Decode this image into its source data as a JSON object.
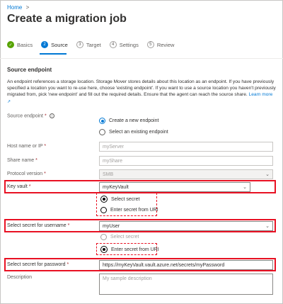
{
  "breadcrumb": {
    "home": "Home",
    "separator": ">"
  },
  "page_title": "Create a migration job",
  "steps": [
    {
      "num": "✓",
      "label": "Basics",
      "state": "done"
    },
    {
      "num": "2",
      "label": "Source",
      "state": "active"
    },
    {
      "num": "3",
      "label": "Target",
      "state": "pending"
    },
    {
      "num": "4",
      "label": "Settings",
      "state": "pending"
    },
    {
      "num": "5",
      "label": "Review",
      "state": "pending"
    }
  ],
  "section": {
    "title": "Source endpoint",
    "description": "An endpoint references a storage location. Storage Mover stores details about this location as an endpoint. If you have previously specified a location you want to re-use here, choose 'existing endpoint'. If you want to use a source location you haven't previously migrated from, pick 'new endpoint' and fill out the required details. Ensure that the agent can reach the source share.",
    "learn_more": "Learn more"
  },
  "fields": {
    "source_endpoint": {
      "label": "Source endpoint",
      "required": "*",
      "options": [
        "Create a new endpoint",
        "Select an existing endpoint"
      ],
      "selected": "Create a new endpoint"
    },
    "host": {
      "label": "Host name or IP",
      "required": "*",
      "placeholder": "myServer"
    },
    "share": {
      "label": "Share name",
      "required": "*",
      "placeholder": "myShare"
    },
    "protocol": {
      "label": "Protocol version",
      "required": "*",
      "value": "SMB"
    },
    "key_vault": {
      "label": "Key vault",
      "required": "*",
      "value": "myKeyVault"
    },
    "secret_mode_1": {
      "options": [
        "Select secret",
        "Enter secret from URI"
      ],
      "selected": "Select secret"
    },
    "username": {
      "label": "Select secret for username",
      "required": "*",
      "value": "myUser"
    },
    "secret_mode_2": {
      "options": [
        "Select secret",
        "Enter secret from URI"
      ],
      "selected": "Enter secret from URI"
    },
    "password": {
      "label": "Select secret for password",
      "required": "*",
      "value": "https://myKeyVault.vault.azure.net/secrets/myPassword"
    },
    "description": {
      "label": "Description",
      "placeholder": "My sample description"
    }
  },
  "colors": {
    "accent": "#0078d4",
    "highlight": "#e81123",
    "success": "#57a300"
  }
}
